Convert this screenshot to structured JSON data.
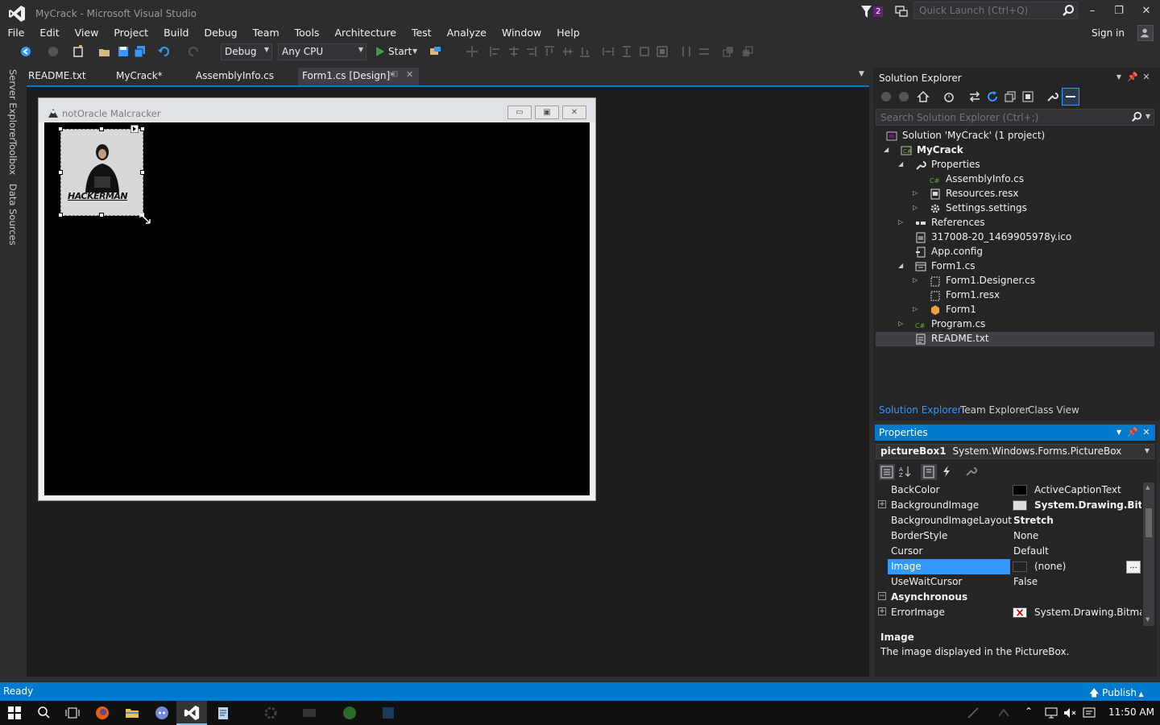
{
  "window": {
    "title": "MyCrack - Microsoft Visual Studio",
    "notification_count": "2",
    "quick_launch_placeholder": "Quick Launch (Ctrl+Q)",
    "sign_in": "Sign in",
    "minimize": "–",
    "maximize": "❐",
    "close": "✕"
  },
  "menu": [
    "File",
    "Edit",
    "View",
    "Project",
    "Build",
    "Debug",
    "Team",
    "Tools",
    "Architecture",
    "Test",
    "Analyze",
    "Window",
    "Help"
  ],
  "toolbar": {
    "configuration": "Debug",
    "platform": "Any CPU",
    "start_label": "Start"
  },
  "side_tabs": [
    "Server Explorer",
    "Toolbox",
    "Data Sources"
  ],
  "doc_tabs": [
    {
      "label": "README.txt",
      "active": false
    },
    {
      "label": "MyCrack*",
      "active": false
    },
    {
      "label": "AssemblyInfo.cs",
      "active": false
    },
    {
      "label": "Form1.cs [Design]*",
      "active": true
    }
  ],
  "form": {
    "title": "notOracle Malcracker",
    "picture_caption": "HACKERMAN"
  },
  "solution_explorer": {
    "title": "Solution Explorer",
    "search_placeholder": "Search Solution Explorer (Ctrl+;)",
    "tree": [
      {
        "label": "Solution 'MyCrack' (1 project)",
        "level": 0,
        "expander": "",
        "icon": "solution-icon",
        "bold": false
      },
      {
        "label": "MyCrack",
        "level": 0,
        "expander": "◢",
        "icon": "csharp-project-icon",
        "bold": true
      },
      {
        "label": "Properties",
        "level": 1,
        "expander": "◢",
        "icon": "wrench-icon",
        "bold": false
      },
      {
        "label": "AssemblyInfo.cs",
        "level": 2,
        "expander": "",
        "icon": "csharp-file-icon",
        "bold": false
      },
      {
        "label": "Resources.resx",
        "level": 2,
        "expander": "▷",
        "icon": "resx-icon",
        "bold": false
      },
      {
        "label": "Settings.settings",
        "level": 2,
        "expander": "▷",
        "icon": "settings-icon",
        "bold": false
      },
      {
        "label": "References",
        "level": 1,
        "expander": "▷",
        "icon": "references-icon",
        "bold": false
      },
      {
        "label": "317008-20_1469905978y.ico",
        "level": 1,
        "expander": "",
        "icon": "ico-file-icon",
        "bold": false
      },
      {
        "label": "App.config",
        "level": 1,
        "expander": "",
        "icon": "config-icon",
        "bold": false
      },
      {
        "label": "Form1.cs",
        "level": 1,
        "expander": "◢",
        "icon": "form-icon",
        "bold": false
      },
      {
        "label": "Form1.Designer.cs",
        "level": 2,
        "expander": "▷",
        "icon": "designer-file-icon",
        "bold": false
      },
      {
        "label": "Form1.resx",
        "level": 2,
        "expander": "",
        "icon": "resx-icon",
        "bold": false
      },
      {
        "label": "Form1",
        "level": 2,
        "expander": "▷",
        "icon": "class-icon",
        "bold": false
      },
      {
        "label": "Program.cs",
        "level": 1,
        "expander": "▷",
        "icon": "csharp-file-icon",
        "bold": false
      },
      {
        "label": "README.txt",
        "level": 1,
        "expander": "",
        "icon": "text-file-icon",
        "bold": false,
        "selected": true
      }
    ],
    "bottom_tabs": [
      "Solution Explorer",
      "Team Explorer",
      "Class View"
    ]
  },
  "properties": {
    "title": "Properties",
    "object_name": "pictureBox1",
    "object_type": "System.Windows.Forms.PictureBox",
    "rows": [
      {
        "name": "BackColor",
        "value": "ActiveCaptionText",
        "expander": "",
        "swatch": "#000000",
        "bold": false
      },
      {
        "name": "BackgroundImage",
        "value": "System.Drawing.Bitmap",
        "expander": "+",
        "swatch": "image",
        "bold": true
      },
      {
        "name": "BackgroundImageLayout",
        "value": "Stretch",
        "expander": "",
        "swatch": "",
        "bold": true
      },
      {
        "name": "BorderStyle",
        "value": "None",
        "expander": "",
        "swatch": "",
        "bold": false
      },
      {
        "name": "Cursor",
        "value": "Default",
        "expander": "",
        "swatch": "",
        "bold": false
      },
      {
        "name": "Image",
        "value": "(none)",
        "expander": "",
        "swatch": "#222222",
        "bold": false,
        "selected": true
      },
      {
        "name": "UseWaitCursor",
        "value": "False",
        "expander": "",
        "swatch": "",
        "bold": false
      },
      {
        "name": "Asynchronous",
        "value": "",
        "expander": "−",
        "swatch": "",
        "bold": false,
        "category": true
      },
      {
        "name": "ErrorImage",
        "value": "System.Drawing.Bitmap",
        "expander": "+",
        "swatch": "error",
        "bold": false
      }
    ],
    "ellipsis": "...",
    "description_title": "Image",
    "description_text": "The image displayed in the PictureBox."
  },
  "status": {
    "text": "Ready",
    "publish": "Publish"
  },
  "taskbar": {
    "time": "11:50 AM"
  },
  "colors": {
    "accent": "#007acc",
    "background": "#2d2d30",
    "panel": "#252526",
    "selection": "#3399ff",
    "vs_purple": "#68217a"
  }
}
